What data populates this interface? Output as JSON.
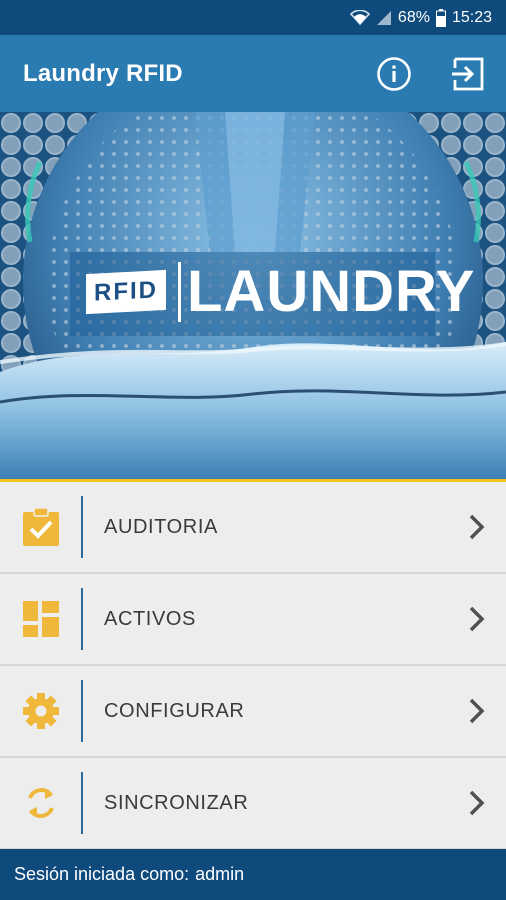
{
  "status_bar": {
    "battery": "68%",
    "time": "15:23",
    "icons": [
      "wifi-icon",
      "signal-icon",
      "battery-icon"
    ]
  },
  "app_bar": {
    "title": "Laundry RFID",
    "actions": [
      "info-icon",
      "logout-icon"
    ]
  },
  "hero": {
    "banner_rfid": "RFID",
    "banner_laundry": "LAUNDRY"
  },
  "menu": {
    "items": [
      {
        "label": "AUDITORIA",
        "icon": "clipboard-check-icon"
      },
      {
        "label": "ACTIVOS",
        "icon": "dashboard-icon"
      },
      {
        "label": "CONFIGURAR",
        "icon": "gear-icon"
      },
      {
        "label": "SINCRONIZAR",
        "icon": "sync-icon"
      }
    ]
  },
  "footer": {
    "session_prefix": "Sesión iniciada como:",
    "username": "admin"
  },
  "colors": {
    "status_bar": "#0f4a7c",
    "app_bar": "#2a7bb1",
    "accent_icon": "#f0b83a",
    "accent_line": "#f2c21a",
    "divider": "#2a6b9e"
  }
}
